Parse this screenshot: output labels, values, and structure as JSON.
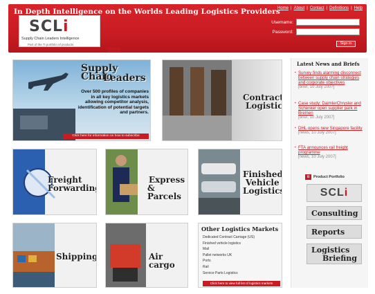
{
  "header": {
    "tagline": "In Depth Intelligence on the Worlds Leading Logistics Providers",
    "links": [
      "Home",
      "About",
      "Contact",
      "Definitions",
      "Help"
    ],
    "login": {
      "username_label": "Username:",
      "password_label": "Password:",
      "signin_label": "Sign in"
    },
    "logo": {
      "mark_a": "SCL",
      "mark_b": "i",
      "subtitle": "Supply Chain Leaders Intelligence",
      "part": "Part of the Ti portfolio of products"
    },
    "nav_home": "Home"
  },
  "tiles": {
    "supply_chain": {
      "title_line1": "Supply Chain",
      "title_line2": "Leaders",
      "desc": "Over 500 profiles of companies in all key logistics markets allowing competitor analysis, identification of potential targets and partners.",
      "cta": "Click here for information on how to subscribe"
    },
    "contract": {
      "line1": "Contract",
      "line2": "Logistics"
    },
    "freight": {
      "line1": "Freight",
      "line2": "Forwarding"
    },
    "express": {
      "line1": "Express",
      "line2": "& Parcels"
    },
    "finished": {
      "line1": "Finished",
      "line2": "Vehicle",
      "line3": "Logistics"
    },
    "shipping": {
      "label": "Shipping"
    },
    "aircargo": {
      "label": "Air cargo"
    },
    "other": {
      "title": "Other Logistics Markets",
      "items": [
        "Dedicated Contract Carriage (US)",
        "Finished vehicle logistics",
        "Mail",
        "Pallet networks UK",
        "Ports",
        "Rail",
        "Service Parts Logistics"
      ],
      "cta": "Click here to view full list of logistics markets"
    }
  },
  "news": {
    "title": "Latest News and Briefs",
    "items": [
      {
        "title": "Survey finds alarming disconnect between supply chain strategies and corporate objectives",
        "meta": "[brief, 10 July 2007]"
      },
      {
        "title": "Case study: DaimlerChrysler and Schenker open supplier park in Bremen",
        "meta": "[brief, 10 July 2007]"
      },
      {
        "title": "DHL opens new Singapore facility",
        "meta": "[news, 10 July 2007]"
      },
      {
        "title": "FTA announces rail freight programme",
        "meta": "[news, 10 July 2007]"
      }
    ]
  },
  "portfolio": {
    "heading": "Product Portfolio",
    "badge": "ti",
    "buttons": [
      "Consulting",
      "Reports",
      "Logistics",
      "Briefing"
    ]
  },
  "colors": {
    "brand_red": "#c81c22"
  }
}
